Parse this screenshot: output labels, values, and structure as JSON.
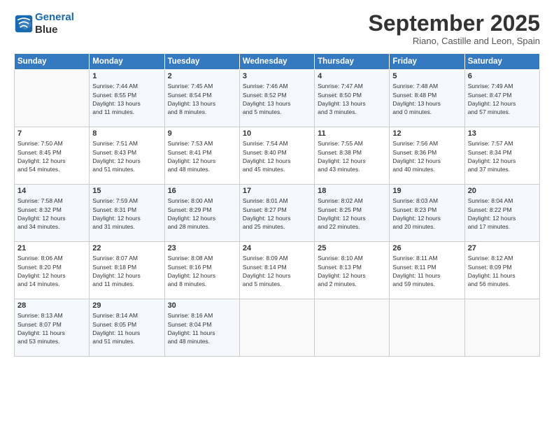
{
  "header": {
    "logo_line1": "General",
    "logo_line2": "Blue",
    "title": "September 2025",
    "subtitle": "Riano, Castille and Leon, Spain"
  },
  "days_of_week": [
    "Sunday",
    "Monday",
    "Tuesday",
    "Wednesday",
    "Thursday",
    "Friday",
    "Saturday"
  ],
  "weeks": [
    [
      {
        "day": "",
        "info": ""
      },
      {
        "day": "1",
        "info": "Sunrise: 7:44 AM\nSunset: 8:55 PM\nDaylight: 13 hours\nand 11 minutes."
      },
      {
        "day": "2",
        "info": "Sunrise: 7:45 AM\nSunset: 8:54 PM\nDaylight: 13 hours\nand 8 minutes."
      },
      {
        "day": "3",
        "info": "Sunrise: 7:46 AM\nSunset: 8:52 PM\nDaylight: 13 hours\nand 5 minutes."
      },
      {
        "day": "4",
        "info": "Sunrise: 7:47 AM\nSunset: 8:50 PM\nDaylight: 13 hours\nand 3 minutes."
      },
      {
        "day": "5",
        "info": "Sunrise: 7:48 AM\nSunset: 8:48 PM\nDaylight: 13 hours\nand 0 minutes."
      },
      {
        "day": "6",
        "info": "Sunrise: 7:49 AM\nSunset: 8:47 PM\nDaylight: 12 hours\nand 57 minutes."
      }
    ],
    [
      {
        "day": "7",
        "info": "Sunrise: 7:50 AM\nSunset: 8:45 PM\nDaylight: 12 hours\nand 54 minutes."
      },
      {
        "day": "8",
        "info": "Sunrise: 7:51 AM\nSunset: 8:43 PM\nDaylight: 12 hours\nand 51 minutes."
      },
      {
        "day": "9",
        "info": "Sunrise: 7:53 AM\nSunset: 8:41 PM\nDaylight: 12 hours\nand 48 minutes."
      },
      {
        "day": "10",
        "info": "Sunrise: 7:54 AM\nSunset: 8:40 PM\nDaylight: 12 hours\nand 45 minutes."
      },
      {
        "day": "11",
        "info": "Sunrise: 7:55 AM\nSunset: 8:38 PM\nDaylight: 12 hours\nand 43 minutes."
      },
      {
        "day": "12",
        "info": "Sunrise: 7:56 AM\nSunset: 8:36 PM\nDaylight: 12 hours\nand 40 minutes."
      },
      {
        "day": "13",
        "info": "Sunrise: 7:57 AM\nSunset: 8:34 PM\nDaylight: 12 hours\nand 37 minutes."
      }
    ],
    [
      {
        "day": "14",
        "info": "Sunrise: 7:58 AM\nSunset: 8:32 PM\nDaylight: 12 hours\nand 34 minutes."
      },
      {
        "day": "15",
        "info": "Sunrise: 7:59 AM\nSunset: 8:31 PM\nDaylight: 12 hours\nand 31 minutes."
      },
      {
        "day": "16",
        "info": "Sunrise: 8:00 AM\nSunset: 8:29 PM\nDaylight: 12 hours\nand 28 minutes."
      },
      {
        "day": "17",
        "info": "Sunrise: 8:01 AM\nSunset: 8:27 PM\nDaylight: 12 hours\nand 25 minutes."
      },
      {
        "day": "18",
        "info": "Sunrise: 8:02 AM\nSunset: 8:25 PM\nDaylight: 12 hours\nand 22 minutes."
      },
      {
        "day": "19",
        "info": "Sunrise: 8:03 AM\nSunset: 8:23 PM\nDaylight: 12 hours\nand 20 minutes."
      },
      {
        "day": "20",
        "info": "Sunrise: 8:04 AM\nSunset: 8:22 PM\nDaylight: 12 hours\nand 17 minutes."
      }
    ],
    [
      {
        "day": "21",
        "info": "Sunrise: 8:06 AM\nSunset: 8:20 PM\nDaylight: 12 hours\nand 14 minutes."
      },
      {
        "day": "22",
        "info": "Sunrise: 8:07 AM\nSunset: 8:18 PM\nDaylight: 12 hours\nand 11 minutes."
      },
      {
        "day": "23",
        "info": "Sunrise: 8:08 AM\nSunset: 8:16 PM\nDaylight: 12 hours\nand 8 minutes."
      },
      {
        "day": "24",
        "info": "Sunrise: 8:09 AM\nSunset: 8:14 PM\nDaylight: 12 hours\nand 5 minutes."
      },
      {
        "day": "25",
        "info": "Sunrise: 8:10 AM\nSunset: 8:13 PM\nDaylight: 12 hours\nand 2 minutes."
      },
      {
        "day": "26",
        "info": "Sunrise: 8:11 AM\nSunset: 8:11 PM\nDaylight: 11 hours\nand 59 minutes."
      },
      {
        "day": "27",
        "info": "Sunrise: 8:12 AM\nSunset: 8:09 PM\nDaylight: 11 hours\nand 56 minutes."
      }
    ],
    [
      {
        "day": "28",
        "info": "Sunrise: 8:13 AM\nSunset: 8:07 PM\nDaylight: 11 hours\nand 53 minutes."
      },
      {
        "day": "29",
        "info": "Sunrise: 8:14 AM\nSunset: 8:05 PM\nDaylight: 11 hours\nand 51 minutes."
      },
      {
        "day": "30",
        "info": "Sunrise: 8:16 AM\nSunset: 8:04 PM\nDaylight: 11 hours\nand 48 minutes."
      },
      {
        "day": "",
        "info": ""
      },
      {
        "day": "",
        "info": ""
      },
      {
        "day": "",
        "info": ""
      },
      {
        "day": "",
        "info": ""
      }
    ]
  ]
}
